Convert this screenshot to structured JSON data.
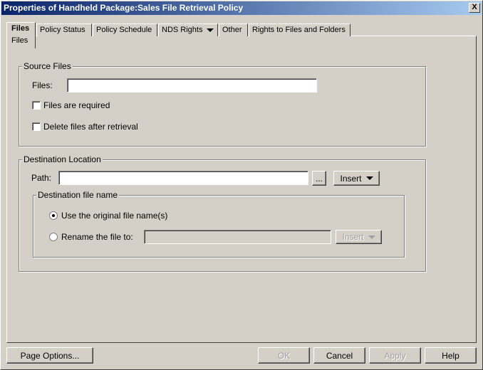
{
  "window": {
    "title": "Properties of Handheld Package:Sales File Retrieval Policy",
    "close_label": "X"
  },
  "tabs": [
    {
      "label": "Files",
      "sub": "Files"
    },
    {
      "label": "Policy Status"
    },
    {
      "label": "Policy Schedule"
    },
    {
      "label": "NDS Rights"
    },
    {
      "label": "Other"
    },
    {
      "label": "Rights to Files and Folders"
    }
  ],
  "source": {
    "legend": "Source Files",
    "files_label": "Files:",
    "files_value": "",
    "required_label": "Files are required",
    "required_checked": false,
    "delete_label": "Delete files after retrieval",
    "delete_checked": false
  },
  "destination": {
    "legend": "Destination Location",
    "path_label": "Path:",
    "path_value": "",
    "browse_label": "...",
    "insert_label": "Insert",
    "filename": {
      "legend": "Destination file name",
      "original_label": "Use the original file name(s)",
      "rename_label": "Rename the file to:",
      "rename_value": "",
      "insert_label": "Insert",
      "selected": "original"
    }
  },
  "buttons": {
    "page_options": "Page Options...",
    "ok": "OK",
    "cancel": "Cancel",
    "apply": "Apply",
    "help": "Help"
  }
}
